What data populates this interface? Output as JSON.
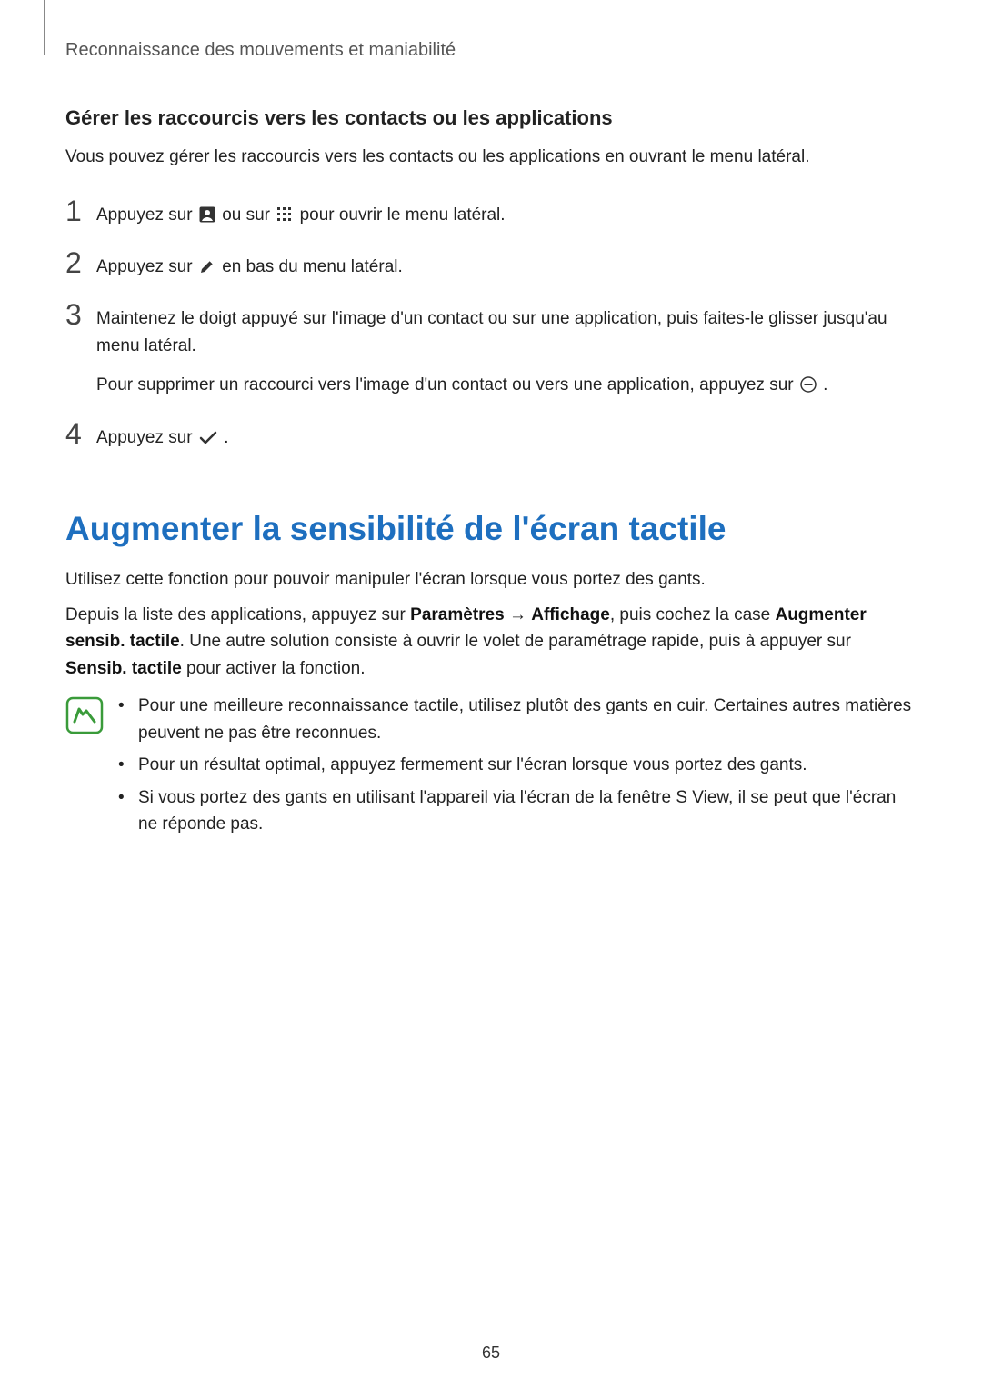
{
  "header": "Reconnaissance des mouvements et maniabilité",
  "section1": {
    "title": "Gérer les raccourcis vers les contacts ou les applications",
    "intro": "Vous pouvez gérer les raccourcis vers les contacts ou les applications en ouvrant le menu latéral.",
    "steps": {
      "s1_a": "Appuyez sur ",
      "s1_b": " ou sur ",
      "s1_c": " pour ouvrir le menu latéral.",
      "s2_a": "Appuyez sur ",
      "s2_b": " en bas du menu latéral.",
      "s3_a": "Maintenez le doigt appuyé sur l'image d'un contact ou sur une application, puis faites-le glisser jusqu'au menu latéral.",
      "s3_b_a": "Pour supprimer un raccourci vers l'image d'un contact ou vers une application, appuyez sur ",
      "s3_b_b": ".",
      "s4_a": "Appuyez sur ",
      "s4_b": "."
    },
    "nums": {
      "n1": "1",
      "n2": "2",
      "n3": "3",
      "n4": "4"
    }
  },
  "section2": {
    "title": "Augmenter la sensibilité de l'écran tactile",
    "p1": "Utilisez cette fonction pour pouvoir manipuler l'écran lorsque vous portez des gants.",
    "p2_a": "Depuis la liste des applications, appuyez sur ",
    "p2_param": "Paramètres",
    "p2_arrow": " → ",
    "p2_aff": "Affichage",
    "p2_b": ", puis cochez la case ",
    "p2_aug": "Augmenter sensib. tactile",
    "p2_c": ". Une autre solution consiste à ouvrir le volet de paramétrage rapide, puis à appuyer sur ",
    "p2_sens": "Sensib. tactile",
    "p2_d": " pour activer la fonction.",
    "bullets": {
      "b1": "Pour une meilleure reconnaissance tactile, utilisez plutôt des gants en cuir. Certaines autres matières peuvent ne pas être reconnues.",
      "b2": "Pour un résultat optimal, appuyez fermement sur l'écran lorsque vous portez des gants.",
      "b3": "Si vous portez des gants en utilisant l'appareil via l'écran de la fenêtre S View, il se peut que l'écran ne réponde pas."
    }
  },
  "page_number": "65",
  "icons": {
    "contact": "contact-icon",
    "apps_grid": "apps-grid-icon",
    "pen": "pen-icon",
    "minus_circle": "minus-circle-icon",
    "check": "check-icon",
    "note": "note-icon"
  }
}
